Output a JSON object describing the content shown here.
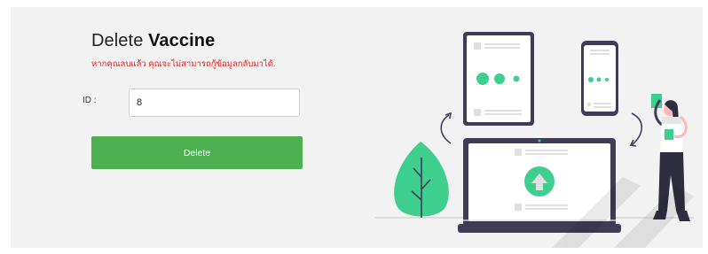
{
  "form": {
    "title_prefix": "Delete",
    "title_bold": "Vaccine",
    "warning": "หากคุณลบแล้ว คุณจะไม่สามารถกู้ข้อมูลกลับมาได้.",
    "id_label": "ID :",
    "id_value": "8",
    "delete_label": "Delete"
  },
  "colors": {
    "accent": "#4caf50",
    "warning": "#e02020",
    "illustration_green": "#3ecf8e",
    "device_dark": "#3f3d56"
  },
  "icons": [
    "upload-arrow-icon",
    "refresh-arrow-icon"
  ]
}
